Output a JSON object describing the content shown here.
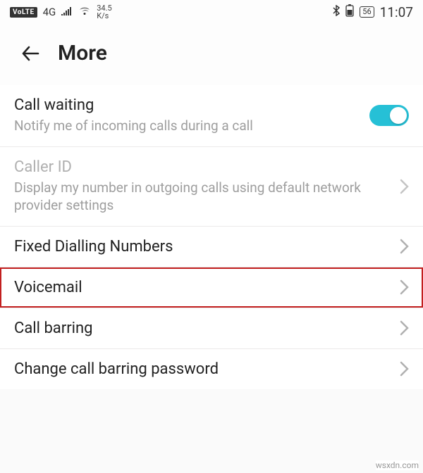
{
  "statusbar": {
    "volte": "VoLTE",
    "mobile": "4G",
    "speed_top": "34.5",
    "speed_bottom": "K/s",
    "battery": "56",
    "time": "11:07"
  },
  "header": {
    "title": "More"
  },
  "settings": {
    "call_waiting": {
      "title": "Call waiting",
      "subtitle": "Notify me of incoming calls during a call",
      "enabled": true
    },
    "caller_id": {
      "title": "Caller ID",
      "subtitle": "Display my number in outgoing calls using default network provider settings"
    },
    "fixed_dialling": {
      "title": "Fixed Dialling Numbers"
    },
    "voicemail": {
      "title": "Voicemail"
    },
    "call_barring": {
      "title": "Call barring"
    },
    "change_pw": {
      "title": "Change call barring password"
    }
  },
  "watermark": "wsxdn.com"
}
